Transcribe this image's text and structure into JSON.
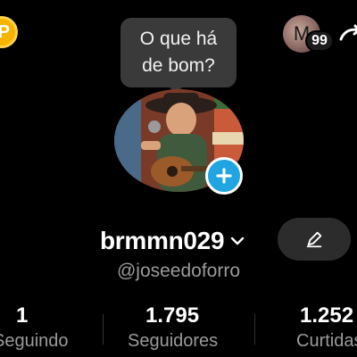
{
  "top_bar": {
    "coin_symbol": "P",
    "bubble_line1": "O que há",
    "bubble_line2": "de bom?",
    "mini_avatar_letter": "M",
    "notification_count": "99"
  },
  "profile": {
    "avatar_icon": "profile-photo",
    "add_icon": "plus-icon",
    "username": "brmmn029",
    "handle": "@joseedoforro",
    "edit_icon": "pencil-icon"
  },
  "stats": [
    {
      "value": "1",
      "label": "Seguindo"
    },
    {
      "value": "1.795",
      "label": "Seguidores"
    },
    {
      "value": "1.252",
      "label": "Curtidas"
    }
  ],
  "colors": {
    "background": "#000000",
    "accent_blue": "#20a5e0",
    "coin": "#f6b400",
    "muted_text": "#9a9a9a"
  }
}
